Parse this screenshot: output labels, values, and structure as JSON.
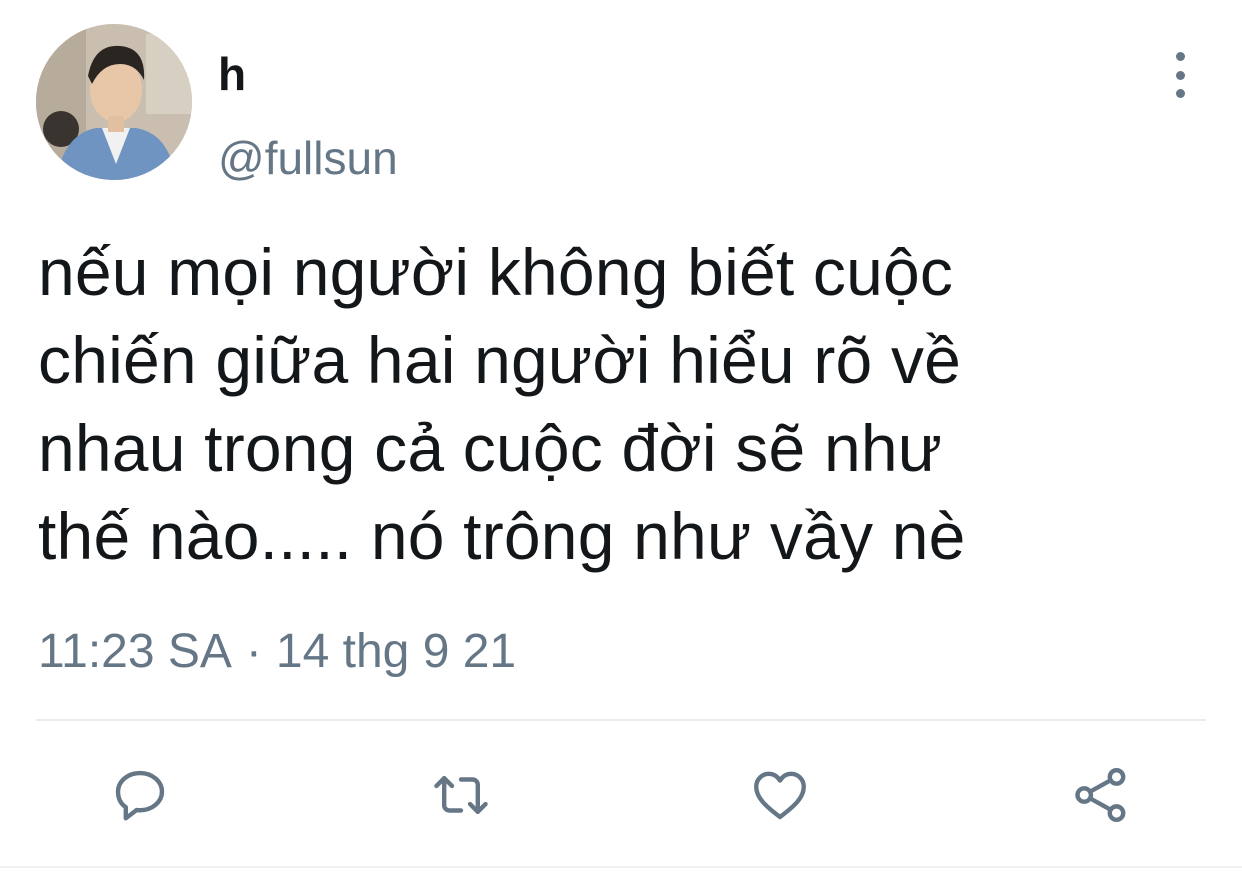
{
  "user": {
    "display_name": "h",
    "handle": "@fullsun"
  },
  "tweet": {
    "text": "nếu mọi người không biết cuộc\nchiến giữa hai người hiểu rõ về\nnhau trong cả cuộc đời sẽ như\nthế nào..... nó trông như vầy nè",
    "time": "11:23 SA",
    "separator": "·",
    "date": "14 thg 9 21"
  },
  "icons": {
    "more": "more-vertical-icon",
    "reply": "reply-icon",
    "retweet": "retweet-icon",
    "like": "heart-icon",
    "share": "share-icon"
  },
  "colors": {
    "text": "#14171a",
    "secondary": "#657786",
    "divider": "#e6ecf0"
  }
}
